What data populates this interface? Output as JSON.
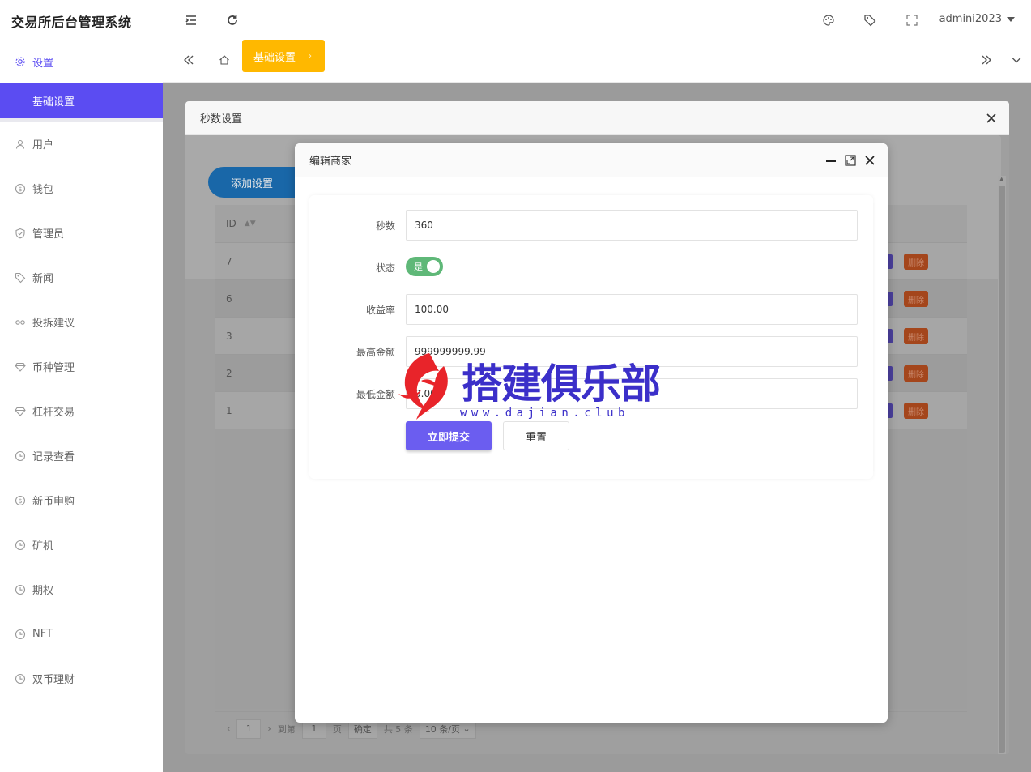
{
  "app": {
    "title": "交易所后台管理系统"
  },
  "header": {
    "username": "admini2023"
  },
  "sidebar": {
    "parent": {
      "label": "设置",
      "icon": "gear-icon"
    },
    "active_sub": {
      "label": "基础设置"
    },
    "items": [
      {
        "label": "用户",
        "icon": "user-icon"
      },
      {
        "label": "钱包",
        "icon": "dollar-icon"
      },
      {
        "label": "管理员",
        "icon": "shield-icon"
      },
      {
        "label": "新闻",
        "icon": "tag-icon"
      },
      {
        "label": "投拆建议",
        "icon": "link-icon"
      },
      {
        "label": "币种管理",
        "icon": "diamond-icon"
      },
      {
        "label": "杠杆交易",
        "icon": "diamond-icon"
      },
      {
        "label": "记录查看",
        "icon": "clock-icon"
      },
      {
        "label": "新币申购",
        "icon": "dollar-icon"
      },
      {
        "label": "矿机",
        "icon": "clock-icon"
      },
      {
        "label": "期权",
        "icon": "clock-icon"
      },
      {
        "label": "NFT",
        "icon": "clock-icon"
      },
      {
        "label": "双币理财",
        "icon": "clock-icon"
      }
    ]
  },
  "tabs": {
    "active_label": "基础设置"
  },
  "outer_modal": {
    "title": "秒数设置",
    "add_button": "添加设置",
    "table": {
      "id_header": "ID",
      "rows": [
        {
          "id": "7",
          "del": "删除"
        },
        {
          "id": "6",
          "del": "删除"
        },
        {
          "id": "3",
          "del": "删除"
        },
        {
          "id": "2",
          "del": "删除"
        },
        {
          "id": "1",
          "del": "删除"
        }
      ]
    },
    "pager": {
      "current": "1",
      "goto_label": "到第",
      "goto_value": "1",
      "page_label": "页",
      "confirm": "确定",
      "total": "共 5 条",
      "per_page": "10 条/页"
    }
  },
  "inner_modal": {
    "title": "编辑商家",
    "fields": {
      "seconds": {
        "label": "秒数",
        "value": "360"
      },
      "status": {
        "label": "状态",
        "toggle_text": "是",
        "on": true
      },
      "rate": {
        "label": "收益率",
        "value": "100.00"
      },
      "max_amount": {
        "label": "最高金额",
        "value": "999999999.99"
      },
      "min_amount": {
        "label": "最低金额",
        "value": "0.00"
      }
    },
    "submit": "立即提交",
    "reset": "重置"
  },
  "watermark": {
    "text": "搭建俱乐部",
    "url": "www.dajian.club"
  },
  "colors": {
    "accent": "#5b4cf2",
    "tab_active": "#ffb800",
    "submit": "#6b5df0",
    "switch_on": "#5fb878",
    "delete": "#a4461c"
  }
}
